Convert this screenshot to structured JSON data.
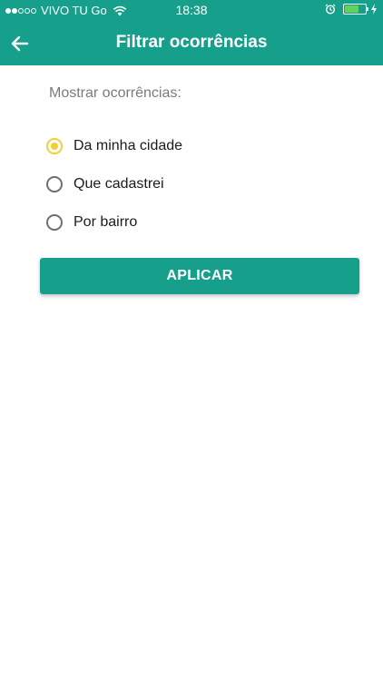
{
  "status_bar": {
    "carrier": "VIVO TU Go",
    "time": "18:38",
    "signal_bars_filled": 2,
    "signal_bars_total": 5,
    "battery_level": 0.7,
    "icons": [
      "signal-dots-icon",
      "wifi-icon",
      "alarm-icon",
      "battery-icon",
      "charging-icon"
    ]
  },
  "app_bar": {
    "title": "Filtrar ocorrências",
    "back_icon": "arrow-left-icon"
  },
  "filter": {
    "section_label": "Mostrar ocorrências:",
    "options": [
      {
        "label": "Da minha cidade",
        "selected": true
      },
      {
        "label": "Que cadastrei",
        "selected": false
      },
      {
        "label": "Por bairro",
        "selected": false
      }
    ],
    "apply_label": "APLICAR"
  },
  "colors": {
    "primary": "#16a08b",
    "radio_selected": "#f2cf38",
    "label_gray": "#7a7a7a",
    "battery_green": "#5fd35f"
  }
}
